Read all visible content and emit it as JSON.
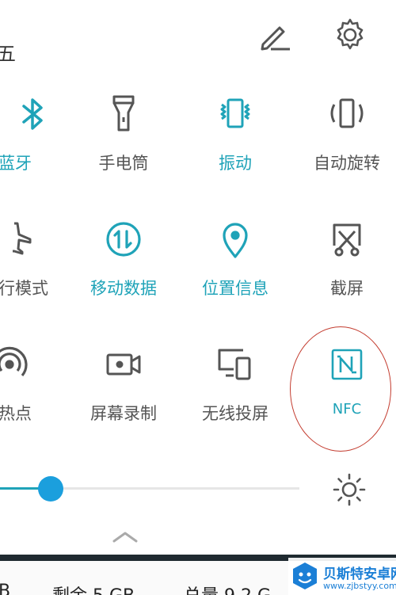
{
  "header": {
    "date_fragment": "五",
    "edit_icon": "pencil-icon",
    "settings_icon": "gear-icon"
  },
  "tiles": [
    {
      "label": "蓝牙",
      "icon": "bluetooth-icon",
      "active": true
    },
    {
      "label": "手电筒",
      "icon": "flashlight-icon",
      "active": false
    },
    {
      "label": "振动",
      "icon": "vibrate-icon",
      "active": true
    },
    {
      "label": "自动旋转",
      "icon": "auto-rotate-icon",
      "active": false
    },
    {
      "label": "行模式",
      "icon": "airplane-icon",
      "active": false
    },
    {
      "label": "移动数据",
      "icon": "mobile-data-icon",
      "active": true
    },
    {
      "label": "位置信息",
      "icon": "location-icon",
      "active": true
    },
    {
      "label": "截屏",
      "icon": "screenshot-icon",
      "active": false
    },
    {
      "label": "热点",
      "icon": "hotspot-icon",
      "active": false
    },
    {
      "label": "屏幕录制",
      "icon": "screen-record-icon",
      "active": false
    },
    {
      "label": "无线投屏",
      "icon": "screen-cast-icon",
      "active": false
    },
    {
      "label": "NFC",
      "icon": "nfc-icon",
      "active": true
    }
  ],
  "brightness": {
    "level": 0.17,
    "icon": "sun-icon"
  },
  "storage": {
    "left_fragment": "B",
    "remaining": "剩余 5 GB",
    "total": "总量 9.2 G"
  },
  "watermark": {
    "title": "贝斯特安卓网",
    "url": "www.zjbstyy.com"
  },
  "colors": {
    "active": "#1fa3b8",
    "inactive": "#555555",
    "slider_thumb": "#1b9fdd",
    "annotation_circle": "#c33b2e"
  }
}
